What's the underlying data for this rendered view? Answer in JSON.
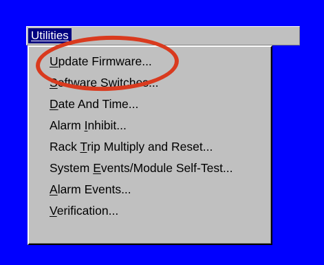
{
  "menubar": {
    "title_accel": "U",
    "title_rest": "tilities"
  },
  "menu": {
    "items": [
      {
        "pre": "",
        "accel": "U",
        "post": "pdate Firmware..."
      },
      {
        "pre": "",
        "accel": "S",
        "post": "oftware Switches..."
      },
      {
        "pre": "",
        "accel": "D",
        "post": "ate And Time..."
      },
      {
        "pre": "Alarm ",
        "accel": "I",
        "post": "nhibit..."
      },
      {
        "pre": "Rack ",
        "accel": "T",
        "post": "rip Multiply and Reset..."
      },
      {
        "pre": "System ",
        "accel": "E",
        "post": "vents/Module Self-Test..."
      },
      {
        "pre": "",
        "accel": "A",
        "post": "larm Events..."
      },
      {
        "pre": "",
        "accel": "V",
        "post": "erification..."
      }
    ]
  },
  "colors": {
    "background": "#0000ff",
    "menu_face": "#c0c0c0",
    "menubar_highlight": "#000080",
    "annotation_ellipse": "#d93a1e"
  }
}
